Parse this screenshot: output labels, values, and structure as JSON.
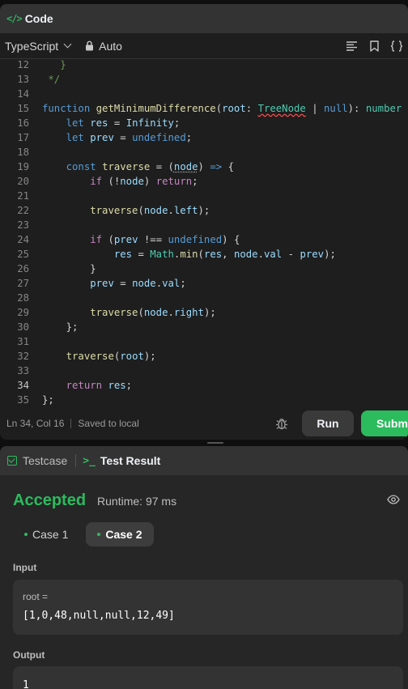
{
  "code_panel": {
    "title": "Code",
    "language": "TypeScript",
    "autocomplete_mode": "Auto",
    "lines": [
      {
        "n": "12",
        "html": "<span class=\"cmt\">   }</span>"
      },
      {
        "n": "13",
        "html": "<span class=\"cmt\"> */</span>"
      },
      {
        "n": "14",
        "html": ""
      },
      {
        "n": "15",
        "html": "<span class=\"kw\">function</span> <span class=\"fn\">getMinimumDifference</span>(<span class=\"var\">root</span>: <span class=\"typ squig\">TreeNode</span> | <span class=\"kw\">null</span>): <span class=\"typ\">number</span> {"
      },
      {
        "n": "16",
        "html": "    <span class=\"kw\">let</span> <span class=\"var\">res</span> = <span class=\"var\">Infinity</span>;"
      },
      {
        "n": "17",
        "html": "    <span class=\"kw\">let</span> <span class=\"var\">prev</span> = <span class=\"kw\">undefined</span>;"
      },
      {
        "n": "18",
        "html": ""
      },
      {
        "n": "19",
        "html": "    <span class=\"kw\">const</span> <span class=\"fn\">traverse</span> = (<span class=\"var dotted\">node</span>) <span class=\"kw\">=&gt;</span> {"
      },
      {
        "n": "20",
        "html": "        <span class=\"kw2\">if</span> (!<span class=\"var\">node</span>) <span class=\"kw2\">return</span>;"
      },
      {
        "n": "21",
        "html": ""
      },
      {
        "n": "22",
        "html": "        <span class=\"fn\">traverse</span>(<span class=\"var\">node</span>.<span class=\"var\">left</span>);"
      },
      {
        "n": "23",
        "html": ""
      },
      {
        "n": "24",
        "html": "        <span class=\"kw2\">if</span> (<span class=\"var\">prev</span> !== <span class=\"kw\">undefined</span>) {"
      },
      {
        "n": "25",
        "html": "            <span class=\"var\">res</span> = <span class=\"typ\">Math</span>.<span class=\"fn\">min</span>(<span class=\"var\">res</span>, <span class=\"var\">node</span>.<span class=\"var\">val</span> - <span class=\"var\">prev</span>);"
      },
      {
        "n": "26",
        "html": "        }"
      },
      {
        "n": "27",
        "html": "        <span class=\"var\">prev</span> = <span class=\"var\">node</span>.<span class=\"var\">val</span>;"
      },
      {
        "n": "28",
        "html": ""
      },
      {
        "n": "29",
        "html": "        <span class=\"fn\">traverse</span>(<span class=\"var\">node</span>.<span class=\"var\">right</span>);"
      },
      {
        "n": "30",
        "html": "    };"
      },
      {
        "n": "31",
        "html": ""
      },
      {
        "n": "32",
        "html": "    <span class=\"fn\">traverse</span>(<span class=\"var\">root</span>);"
      },
      {
        "n": "33",
        "html": ""
      },
      {
        "n": "34",
        "html": "    <span class=\"kw2\">return</span> <span class=\"var\">res</span>;",
        "active": true
      },
      {
        "n": "35",
        "html": "};"
      }
    ],
    "status": {
      "cursor": "Ln 34, Col 16",
      "save_state": "Saved to local"
    },
    "run_label": "Run",
    "submit_label": "Submit"
  },
  "result_panel": {
    "tab_testcase": "Testcase",
    "tab_result": "Test Result",
    "verdict": "Accepted",
    "runtime": "Runtime: 97 ms",
    "cases": [
      "Case 1",
      "Case 2"
    ],
    "active_case": 1,
    "input_label": "Input",
    "input_param": "root =",
    "input_value": "[1,0,48,null,null,12,49]",
    "output_label": "Output",
    "output_value": "1"
  },
  "colors": {
    "accent_green": "#2cbb5d",
    "panel_bg": "#1e1e1e",
    "header_bg": "#333333"
  },
  "icons": {
    "code_title": "code-brackets-icon",
    "lock": "lock-icon",
    "format": "format-lines-icon",
    "bookmark": "bookmark-icon",
    "braces": "braces-icon",
    "debug": "bug-icon",
    "testcase": "checkbox-icon",
    "terminal": "terminal-icon",
    "visibility": "eye-icon"
  }
}
